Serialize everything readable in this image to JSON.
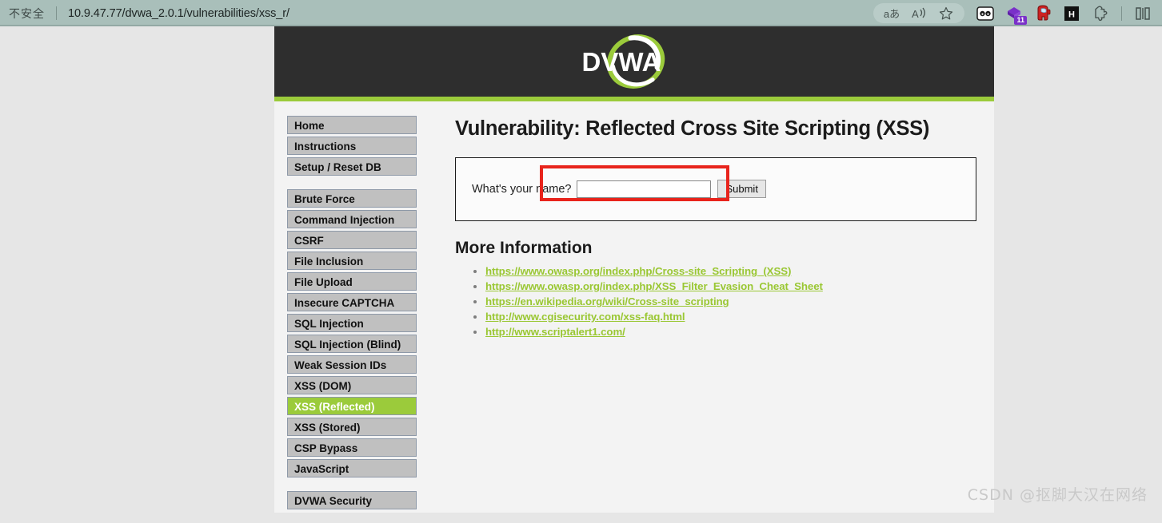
{
  "browser": {
    "security_label": "不安全",
    "url": "10.9.47.77/dvwa_2.0.1/vulnerabilities/xss_r/",
    "toolbar": {
      "translate_label": "aあ",
      "read_aloud_label": "A",
      "favorite_label": "☆",
      "ext_badge_count": "11",
      "h_icon_label": "H"
    }
  },
  "site": {
    "logo_text": "DVWA"
  },
  "sidebar": {
    "groups": [
      {
        "items": [
          {
            "label": "Home",
            "active": false
          },
          {
            "label": "Instructions",
            "active": false
          },
          {
            "label": "Setup / Reset DB",
            "active": false
          }
        ]
      },
      {
        "items": [
          {
            "label": "Brute Force",
            "active": false
          },
          {
            "label": "Command Injection",
            "active": false
          },
          {
            "label": "CSRF",
            "active": false
          },
          {
            "label": "File Inclusion",
            "active": false
          },
          {
            "label": "File Upload",
            "active": false
          },
          {
            "label": "Insecure CAPTCHA",
            "active": false
          },
          {
            "label": "SQL Injection",
            "active": false
          },
          {
            "label": "SQL Injection (Blind)",
            "active": false
          },
          {
            "label": "Weak Session IDs",
            "active": false
          },
          {
            "label": "XSS (DOM)",
            "active": false
          },
          {
            "label": "XSS (Reflected)",
            "active": true
          },
          {
            "label": "XSS (Stored)",
            "active": false
          },
          {
            "label": "CSP Bypass",
            "active": false
          },
          {
            "label": "JavaScript",
            "active": false
          }
        ]
      },
      {
        "items": [
          {
            "label": "DVWA Security",
            "active": false
          }
        ]
      }
    ]
  },
  "main": {
    "page_title": "Vulnerability: Reflected Cross Site Scripting (XSS)",
    "form": {
      "name_label": "What's your name?",
      "name_value": "",
      "name_placeholder": "",
      "submit_label": "Submit"
    },
    "more_information": {
      "heading": "More Information",
      "links": [
        "https://www.owasp.org/index.php/Cross-site_Scripting_(XSS)",
        "https://www.owasp.org/index.php/XSS_Filter_Evasion_Cheat_Sheet",
        "https://en.wikipedia.org/wiki/Cross-site_scripting",
        "http://www.cgisecurity.com/xss-faq.html",
        "http://www.scriptalert1.com/"
      ]
    }
  },
  "annotation": {
    "highlight_color": "#e8241c"
  },
  "watermark": {
    "text": "CSDN @抠脚大汉在网络"
  },
  "colors": {
    "chrome_bg": "#a9bfba",
    "header_bg": "#2e2e2e",
    "accent_green": "#9bcb3b",
    "link_green": "#9ac733",
    "nav_bg": "#c0c0c0",
    "page_bg": "#e6e6e6"
  }
}
